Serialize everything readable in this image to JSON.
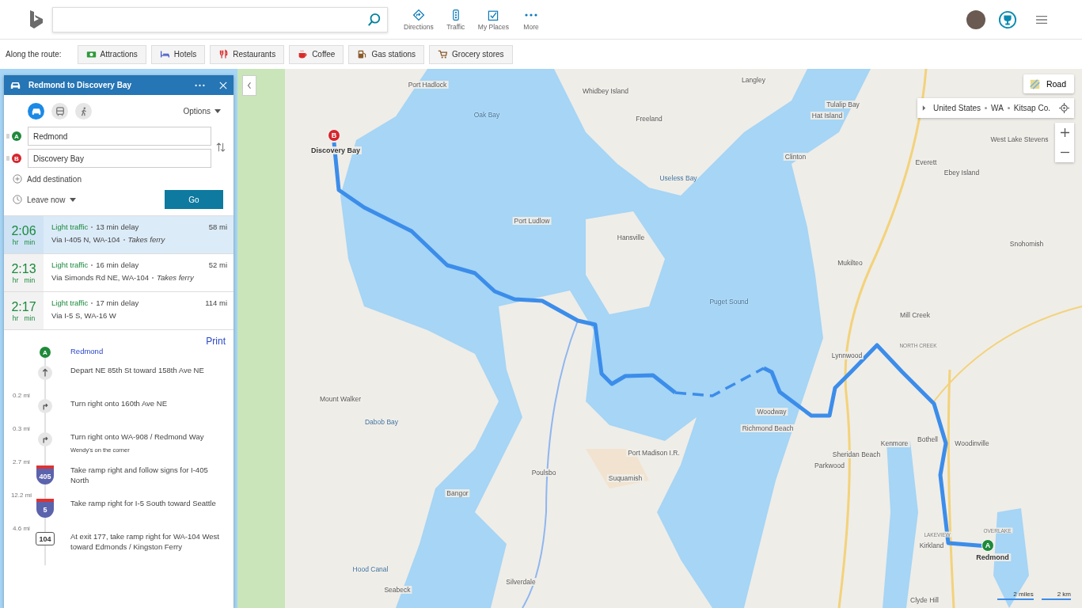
{
  "nav": [
    {
      "kind": "directions",
      "label": "Directions"
    },
    {
      "kind": "traffic",
      "label": "Traffic"
    },
    {
      "kind": "places",
      "label": "My Places"
    },
    {
      "kind": "more",
      "label": "More"
    }
  ],
  "along_route": {
    "label": "Along the route:",
    "items": [
      {
        "kind": "attractions",
        "label": "Attractions"
      },
      {
        "kind": "hotels",
        "label": "Hotels"
      },
      {
        "kind": "restaurants",
        "label": "Restaurants"
      },
      {
        "kind": "coffee",
        "label": "Coffee"
      },
      {
        "kind": "gas",
        "label": "Gas stations"
      },
      {
        "kind": "grocery",
        "label": "Grocery stores"
      }
    ]
  },
  "directions": {
    "title": "Redmond to Discovery Bay",
    "modes": [
      {
        "kind": "car",
        "selected": true
      },
      {
        "kind": "transit",
        "selected": false
      },
      {
        "kind": "walk",
        "selected": false
      }
    ],
    "options": "Options",
    "waypoints": [
      {
        "marker": "A",
        "value": "Redmond"
      },
      {
        "marker": "B",
        "value": "Discovery Bay"
      }
    ],
    "add_destination": "Add destination",
    "leave": "Leave now",
    "go": "Go"
  },
  "routes": [
    {
      "time": "2:06",
      "hr": "hr",
      "min": "min",
      "traffic": "Light traffic",
      "delay": "13 min delay",
      "distance": "58 mi",
      "via": "Via I-405 N, WA-104",
      "ferry": "Takes ferry",
      "selected": true
    },
    {
      "time": "2:13",
      "hr": "hr",
      "min": "min",
      "traffic": "Light traffic",
      "delay": "16 min delay",
      "distance": "52 mi",
      "via": "Via Simonds Rd NE, WA-104",
      "ferry": "Takes ferry",
      "selected": false
    },
    {
      "time": "2:17",
      "hr": "hr",
      "min": "min",
      "traffic": "Light traffic",
      "delay": "17 min delay",
      "distance": "114 mi",
      "via": "Via I-5 S, WA-16 W",
      "selected": false
    }
  ],
  "print": "Print",
  "steps": [
    {
      "kind": "start",
      "badge": "A",
      "text": "Redmond"
    },
    {
      "kind": "straight",
      "text": "Depart NE 85th St toward 158th Ave NE",
      "distance": "0.2 mi"
    },
    {
      "kind": "right",
      "text": "Turn right onto 160th Ave NE",
      "distance": "0.3 mi"
    },
    {
      "kind": "right",
      "text": "Turn right onto WA-908 / Redmond Way",
      "note": "Wendy's on the corner",
      "distance": "2.7 mi"
    },
    {
      "kind": "interstate",
      "badge": "405",
      "text": "Take ramp right and follow signs for I-405 North",
      "distance": "12.2 mi"
    },
    {
      "kind": "interstate",
      "badge": "5",
      "text": "Take ramp right for I-5 South toward Seattle",
      "distance": "4.6 mi"
    },
    {
      "kind": "state",
      "badge": "104",
      "text": "At exit 177, take ramp right for WA-104 West toward Edmonds / Kingston Ferry"
    }
  ],
  "map": {
    "style": "Road",
    "breadcrumb": [
      "United States",
      "WA",
      "Kitsap Co."
    ],
    "start": "A",
    "end": "B",
    "scale": [
      "2 miles",
      "2 km"
    ],
    "labels": [
      {
        "text": "Langley",
        "kind": "place"
      },
      {
        "text": "Port Hadlock",
        "kind": "place"
      },
      {
        "text": "Whidbey Island",
        "kind": "place"
      },
      {
        "text": "Tulalip Bay",
        "kind": "place"
      },
      {
        "text": "Oak Bay",
        "kind": "water"
      },
      {
        "text": "Hat Island",
        "kind": "place"
      },
      {
        "text": "Freeland",
        "kind": "place"
      },
      {
        "text": "West Lake Stevens",
        "kind": "place"
      },
      {
        "text": "Discovery Bay",
        "kind": "city"
      },
      {
        "text": "Clinton",
        "kind": "place"
      },
      {
        "text": "Everett",
        "kind": "place"
      },
      {
        "text": "Ebey Island",
        "kind": "place"
      },
      {
        "text": "Useless Bay",
        "kind": "water"
      },
      {
        "text": "Port Ludlow",
        "kind": "place"
      },
      {
        "text": "Hansville",
        "kind": "place"
      },
      {
        "text": "Snohomish",
        "kind": "place"
      },
      {
        "text": "Mukilteo",
        "kind": "place"
      },
      {
        "text": "Puget Sound",
        "kind": "water"
      },
      {
        "text": "Mill Creek",
        "kind": "place"
      },
      {
        "text": "NORTH CREEK",
        "kind": "area"
      },
      {
        "text": "Lynnwood",
        "kind": "place"
      },
      {
        "text": "Mount Walker",
        "kind": "place"
      },
      {
        "text": "Woodway",
        "kind": "place"
      },
      {
        "text": "Dabob Bay",
        "kind": "water"
      },
      {
        "text": "Richmond Beach",
        "kind": "place"
      },
      {
        "text": "Bothell",
        "kind": "place"
      },
      {
        "text": "Kenmore",
        "kind": "place"
      },
      {
        "text": "Woodinville",
        "kind": "place"
      },
      {
        "text": "Port Madison I.R.",
        "kind": "place"
      },
      {
        "text": "Sheridan Beach",
        "kind": "place"
      },
      {
        "text": "Parkwood",
        "kind": "place"
      },
      {
        "text": "Poulsbo",
        "kind": "place"
      },
      {
        "text": "Suquamish",
        "kind": "place"
      },
      {
        "text": "Bangor",
        "kind": "place"
      },
      {
        "text": "OVERLAKE",
        "kind": "area"
      },
      {
        "text": "LAKEVIEW",
        "kind": "area"
      },
      {
        "text": "Kirkland",
        "kind": "place"
      },
      {
        "text": "Redmond",
        "kind": "city"
      },
      {
        "text": "Hood Canal",
        "kind": "water"
      },
      {
        "text": "Silverdale",
        "kind": "place"
      },
      {
        "text": "Seabeck",
        "kind": "place"
      },
      {
        "text": "Clyde Hill",
        "kind": "place"
      }
    ]
  }
}
